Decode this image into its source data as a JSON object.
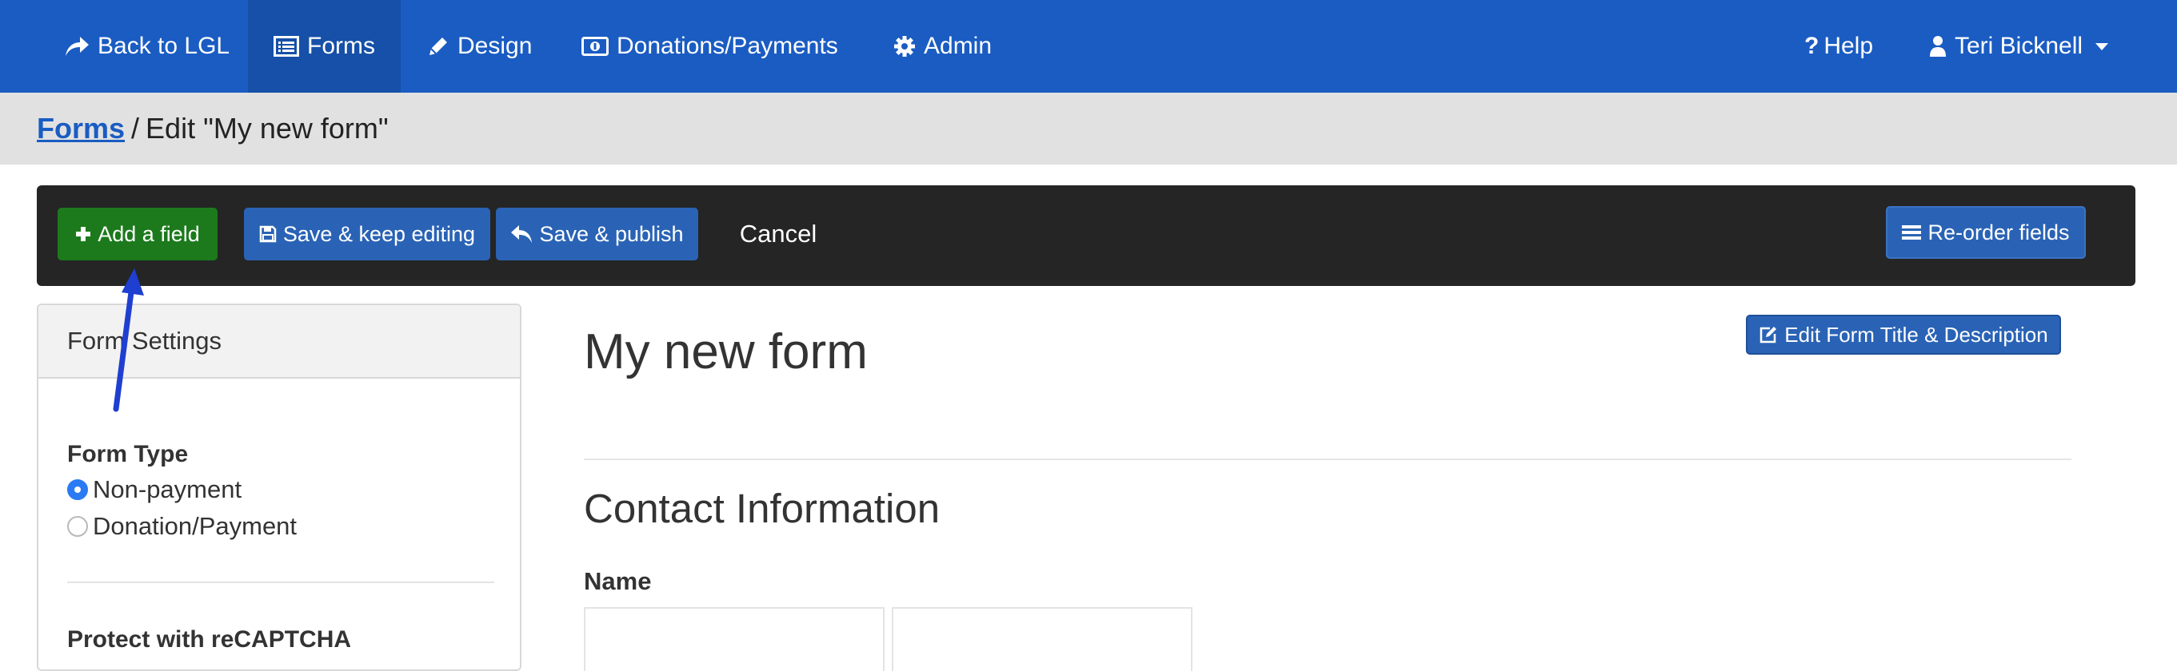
{
  "nav": {
    "back_label": "Back to LGL",
    "forms_label": "Forms",
    "design_label": "Design",
    "donations_label": "Donations/Payments",
    "admin_label": "Admin",
    "help_label": "Help",
    "user_label": "Teri Bicknell"
  },
  "breadcrumb": {
    "root_label": "Forms",
    "separator": "/",
    "current_label": "Edit \"My new form\""
  },
  "toolbar": {
    "add_field_label": "Add a field",
    "save_keep_label": "Save & keep editing",
    "save_publish_label": "Save & publish",
    "cancel_label": "Cancel",
    "reorder_label": "Re-order fields"
  },
  "settings": {
    "heading": "Form Settings",
    "form_type_label": "Form Type",
    "options": [
      {
        "label": "Non-payment",
        "selected": true
      },
      {
        "label": "Donation/Payment",
        "selected": false
      }
    ],
    "recaptcha_label": "Protect with reCAPTCHA"
  },
  "main": {
    "form_title": "My new form",
    "edit_title_button": "Edit Form Title & Description",
    "section_title": "Contact Information",
    "name_label": "Name"
  },
  "colors": {
    "nav_bg": "#1a5cc2",
    "nav_active_bg": "#1650a8",
    "breadcrumb_bg": "#e1e1e1",
    "toolbar_bg": "#252525",
    "primary_button": "#2a63b5",
    "success_button": "#1c7a1c",
    "annotation_arrow": "#1f3fd1"
  },
  "icons": {
    "back": "share-arrow-icon",
    "forms": "list-alt-icon",
    "design": "pencil-icon",
    "donations": "money-icon",
    "admin": "gear-icon",
    "help": "question-icon",
    "user": "user-icon",
    "add": "plus-icon",
    "save": "floppy-disk-icon",
    "publish": "reply-arrow-icon",
    "reorder": "bars-icon",
    "edit": "edit-icon"
  }
}
